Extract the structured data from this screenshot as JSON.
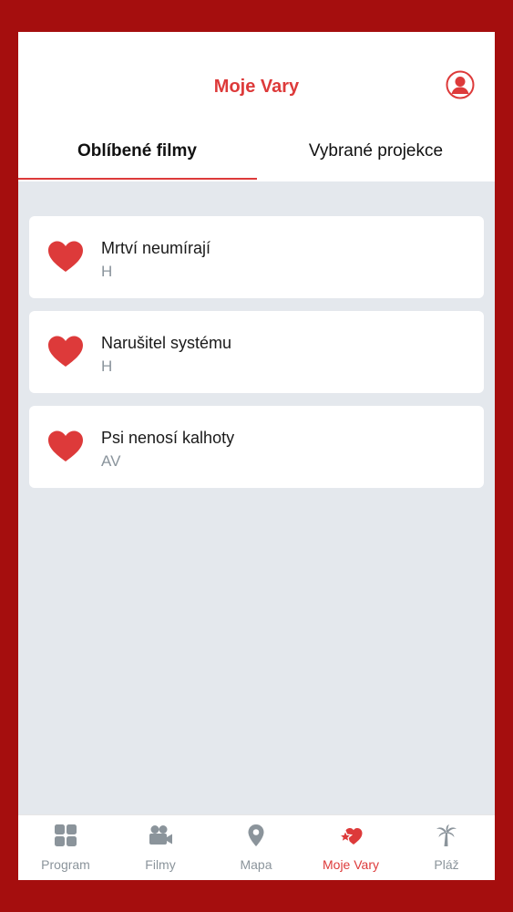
{
  "header": {
    "title": "Moje Vary",
    "profile_icon": "user-profile-icon"
  },
  "tabs": [
    {
      "label": "Oblíbené filmy",
      "active": true
    },
    {
      "label": "Vybrané projekce",
      "active": false
    }
  ],
  "favorites": [
    {
      "title": "Mrtví neumírají",
      "section": "H",
      "icon": "heart-icon"
    },
    {
      "title": "Narušitel systému",
      "section": "H",
      "icon": "heart-icon"
    },
    {
      "title": "Psi nenosí kalhoty",
      "section": "AV",
      "icon": "heart-icon"
    }
  ],
  "bottom_nav": [
    {
      "label": "Program",
      "icon": "grid-icon",
      "active": false
    },
    {
      "label": "Filmy",
      "icon": "video-camera-icon",
      "active": false
    },
    {
      "label": "Mapa",
      "icon": "map-pin-icon",
      "active": false
    },
    {
      "label": "Moje Vary",
      "icon": "heart-star-icon",
      "active": true
    },
    {
      "label": "Pláž",
      "icon": "palm-tree-icon",
      "active": false
    }
  ],
  "colors": {
    "frame": "#a50e0e",
    "accent": "#dd3a3a",
    "background": "#e4e8ed",
    "muted": "#8b949b"
  }
}
